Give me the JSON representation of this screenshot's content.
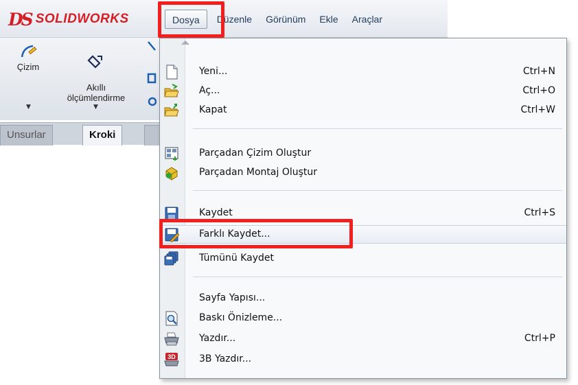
{
  "app": {
    "brand": "SOLIDWORKS",
    "brand_mark": "DS",
    "brand_color": "#d41f26"
  },
  "menubar": {
    "items": [
      "Dosya",
      "Düzenle",
      "Görünüm",
      "Ekle",
      "Araçlar"
    ],
    "active": "Dosya"
  },
  "ribbon": {
    "tools": [
      {
        "label": "Çizim",
        "icon": "sketch-pencil-icon"
      },
      {
        "label": "Akıllı\nölçümlendirme",
        "icon": "smart-dimension-icon"
      }
    ],
    "tabs": [
      "Unsurlar",
      "Kroki"
    ],
    "active_tab": "Kroki"
  },
  "file_menu": {
    "items": [
      {
        "label": "Yeni...",
        "shortcut": "Ctrl+N",
        "icon": "new-document-icon"
      },
      {
        "label": "Aç...",
        "shortcut": "Ctrl+O",
        "icon": "open-folder-icon"
      },
      {
        "label": "Kapat",
        "shortcut": "Ctrl+W",
        "icon": "close-folder-icon"
      },
      {
        "label": "Parçadan Çizim Oluştur",
        "shortcut": "",
        "icon": "make-drawing-icon"
      },
      {
        "label": "Parçadan Montaj Oluştur",
        "shortcut": "",
        "icon": "make-assembly-icon"
      },
      {
        "label": "Kaydet",
        "shortcut": "Ctrl+S",
        "icon": "save-icon"
      },
      {
        "label": "Farklı Kaydet...",
        "shortcut": "",
        "icon": "save-as-icon"
      },
      {
        "label": "Tümünü Kaydet",
        "shortcut": "",
        "icon": "save-all-icon"
      },
      {
        "label": "Sayfa Yapısı...",
        "shortcut": "",
        "icon": ""
      },
      {
        "label": "Baskı Önizleme...",
        "shortcut": "",
        "icon": "print-preview-icon"
      },
      {
        "label": "Yazdır...",
        "shortcut": "Ctrl+P",
        "icon": "printer-icon"
      },
      {
        "label": "3B Yazdır...",
        "shortcut": "",
        "icon": "print-3d-icon"
      }
    ],
    "highlighted": "Farklı Kaydet..."
  },
  "annotation": {
    "highlight_color": "#f21f1f"
  }
}
